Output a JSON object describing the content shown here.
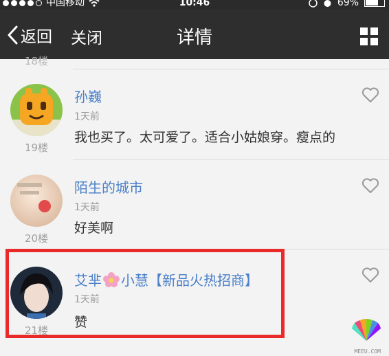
{
  "status_bar": {
    "carrier": "中国移动",
    "time": "10:46",
    "battery": "69%",
    "battery_level": 0.69
  },
  "nav": {
    "back_label": "返回",
    "close_label": "关闭",
    "title": "详情"
  },
  "list": {
    "partial_floor": "18楼",
    "items": [
      {
        "name": "孙巍",
        "time": "1天前",
        "content": "我也买了。太可爱了。适合小姑娘穿。瘦点的",
        "floor": "19楼"
      },
      {
        "name": "陌生的城市",
        "time": "1天前",
        "content": "好美啊",
        "floor": "20楼"
      },
      {
        "name_part1": "艾芈",
        "name_part2": "小慧【新品火热招商】",
        "time": "1天前",
        "content": "赞",
        "floor": "21楼"
      }
    ]
  },
  "watermark": "MEEU.COM",
  "colors": {
    "accent": "#4a7fc9",
    "navbar": "#2e2e2e",
    "highlight": "#ea2a2a"
  }
}
